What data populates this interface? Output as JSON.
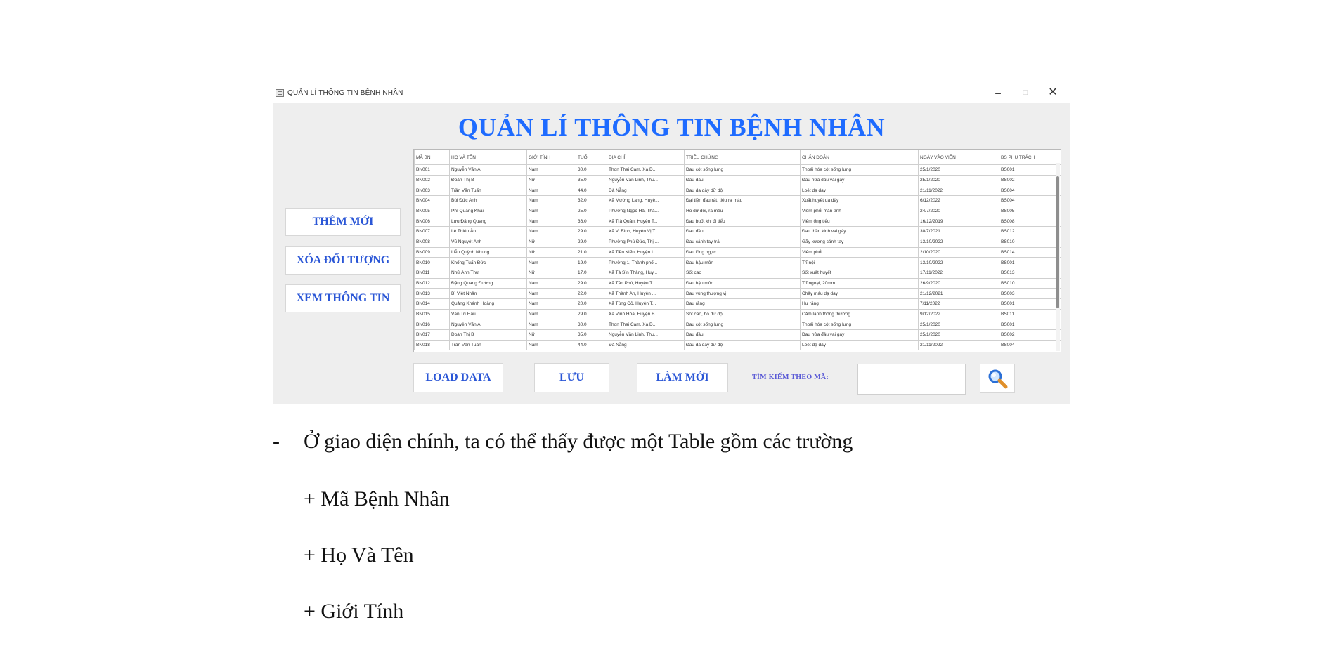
{
  "window": {
    "title": "QUẢN LÍ THÔNG TIN BỆNH NHÂN",
    "controls": {
      "minimize": "–",
      "maximize": "□",
      "close": "✕"
    }
  },
  "app": {
    "heading": "QUẢN LÍ THÔNG TIN BỆNH NHÂN"
  },
  "sidebar": {
    "add": "THÊM MỚI",
    "delete": "XÓA ĐỐI TƯỢNG",
    "view": "XEM THÔNG TIN"
  },
  "table": {
    "columns": [
      "MÃ BN",
      "HỌ VÀ TÊN",
      "GIỚI TÍNH",
      "TUỔI",
      "ĐỊA CHỈ",
      "TRIỆU CHỨNG",
      "CHẨN ĐOÁN",
      "NGÀY VÀO VIỆN",
      "BS PHỤ TRÁCH"
    ],
    "rows": [
      [
        "BN001",
        "Nguyễn Văn A",
        "Nam",
        "30.0",
        "Thon Thai Cam, Xa D...",
        "Đau cột sống lưng",
        "Thoái hóa cột sống lưng",
        "25/1/2020",
        "BS001"
      ],
      [
        "BN002",
        "Đoàn Thị B",
        "Nữ",
        "35.0",
        "Nguyễn Văn Linh, Thu...",
        "Đau đầu",
        "Đau nửa đầu vai gáy",
        "25/1/2020",
        "BS002"
      ],
      [
        "BN003",
        "Trần Văn Tuấn",
        "Nam",
        "44.0",
        "Đà Nẵng",
        "Đau da dày dữ dội",
        "Loét dạ dày",
        "21/11/2022",
        "BS004"
      ],
      [
        "BN004",
        "Bùi Đức Anh",
        "Nam",
        "32.0",
        "Xã Mường Lang, Huyệ...",
        "Đại tiện đau rát, tiêu ra máu",
        "Xuất huyết dạ dày",
        "6/12/2022",
        "BS004"
      ],
      [
        "BN005",
        "Phí Quang Khải",
        "Nam",
        "25.0",
        "Phường Ngọc Hà, Thà...",
        "Ho dữ dội, ra máu",
        "Viêm phổi màn tính",
        "24/7/2020",
        "BS005"
      ],
      [
        "BN006",
        "Lưu Đặng Quang",
        "Nam",
        "36.0",
        "Xã Trà Quân, Huyện T...",
        "Đau buốt khi đi tiểu",
        "Viêm ống tiểu",
        "16/12/2019",
        "BS008"
      ],
      [
        "BN007",
        "Lê Thiên Ân",
        "Nam",
        "29.0",
        "Xã Vi Bình, Huyện Vị T...",
        "Đau đầu",
        "Đau thần kinh vai gáy",
        "30/7/2021",
        "BS012"
      ],
      [
        "BN008",
        "Vũ Nguyệt Anh",
        "Nữ",
        "29.0",
        "Phường Phú Đức, Thị ...",
        "Đau cánh tay trái",
        "Gãy xương cánh tay",
        "13/10/2022",
        "BS010"
      ],
      [
        "BN009",
        "Liễu Quỳnh Nhung",
        "Nữ",
        "21.0",
        "Xã Tiền Kiến, Huyện L...",
        "Đau lồng ngực",
        "Viêm phổi",
        "2/10/2020",
        "BS014"
      ],
      [
        "BN010",
        "Khổng Tuấn Đức",
        "Nam",
        "19.0",
        "Phường 1, Thành phố...",
        "Đau hậu môn",
        "Trĩ nội",
        "13/10/2022",
        "BS001"
      ],
      [
        "BN011",
        "Nhữ Anh Thư",
        "Nữ",
        "17.0",
        "Xã Tà Sìn Thàng, Huy...",
        "Sốt cao",
        "Sốt xuất huyết",
        "17/11/2022",
        "BS013"
      ],
      [
        "BN012",
        "Đặng Quang Đường",
        "Nam",
        "29.0",
        "Xã Tân Phú, Huyện T...",
        "Đau hậu môn",
        "Trĩ ngoại, 20mm",
        "26/9/2020",
        "BS010"
      ],
      [
        "BN013",
        "Bì Việt Nhân",
        "Nam",
        "22.0",
        "Xã Thành An, Huyện ...",
        "Đau vùng thượng vị",
        "Chảy máu dạ dày",
        "21/12/2021",
        "BS003"
      ],
      [
        "BN014",
        "Quảng Khánh Hoàng",
        "Nam",
        "20.0",
        "Xã Tùng Cỏ, Huyện T...",
        "Đau răng",
        "Hư răng",
        "7/11/2022",
        "BS001"
      ],
      [
        "BN015",
        "Văn Trí Hậu",
        "Nam",
        "29.0",
        "Xã Vĩnh Hòa, Huyện B...",
        "Sốt cao, ho dữ dội",
        "Cảm lạnh thông thường",
        "9/12/2022",
        "BS011"
      ],
      [
        "BN016",
        "Nguyễn Văn A",
        "Nam",
        "30.0",
        "Thon Thai Cam, Xa D...",
        "Đau cột sống lưng",
        "Thoái hóa cột sống lưng",
        "25/1/2020",
        "BS001"
      ],
      [
        "BN017",
        "Đoàn Thị B",
        "Nữ",
        "35.0",
        "Nguyễn Văn Linh, Thu...",
        "Đau đầu",
        "Đau nửa đầu vai gáy",
        "25/1/2020",
        "BS002"
      ],
      [
        "BN018",
        "Trần Văn Tuấn",
        "Nam",
        "44.0",
        "Đà Nẵng",
        "Đau da dày dữ dội",
        "Loét dạ dày",
        "21/11/2022",
        "BS004"
      ]
    ]
  },
  "bottom": {
    "load": "LOAD DATA",
    "save": "LƯU",
    "refresh": "LÀM MỚI",
    "search_label": "TÌM KIẾM THEO MÃ:",
    "search_value": "",
    "search_icon": "search-icon"
  },
  "document": {
    "dash": "-",
    "paragraph": "Ở giao diện chính, ta có thể thấy được một Table gồm các trường",
    "items": [
      "+ Mã Bệnh Nhân",
      "+ Họ Và Tên",
      "+ Giới Tính"
    ]
  }
}
